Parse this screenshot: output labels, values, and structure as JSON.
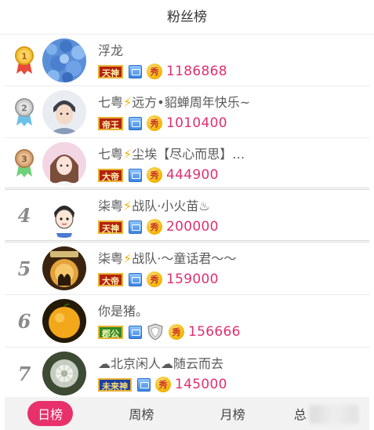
{
  "header": {
    "title": "粉丝榜"
  },
  "rows": [
    {
      "rank": "",
      "name_a": "浮龙",
      "name_b": "",
      "title": "天神",
      "score": "1186868"
    },
    {
      "rank": "",
      "name_a": "七粤",
      "name_b": "远方•貂蝉周年快乐~",
      "title": "帝王",
      "score": "1010400"
    },
    {
      "rank": "",
      "name_a": "七粤",
      "name_b": "尘埃【尽心而思】…",
      "title": "大帝",
      "score": "444900"
    },
    {
      "rank": "4",
      "name_a": "柒粤",
      "name_b": "战队·小火苗♨",
      "title": "天神",
      "score": "200000"
    },
    {
      "rank": "5",
      "name_a": "柒粤",
      "name_b": "战队·～童话君～～",
      "title": "大帝",
      "score": "159000"
    },
    {
      "rank": "6",
      "name_a": "你是猪。",
      "name_b": "",
      "title": "郡公",
      "score": "156666"
    },
    {
      "rank": "7",
      "name_a": "☁北京闲人☁随云而去",
      "name_b": "",
      "title": "未来神",
      "score": "145000"
    }
  ],
  "medals": [
    "1",
    "2",
    "3"
  ],
  "xiu_label": "秀",
  "bolt": "⚡",
  "tabs": [
    {
      "label": "日榜",
      "active": true
    },
    {
      "label": "周榜",
      "active": false
    },
    {
      "label": "月榜",
      "active": false
    },
    {
      "label": "总",
      "active": false
    }
  ],
  "colors": {
    "accent": "#e8306b",
    "score": "#e0306f",
    "gold": "#f2b300",
    "silver": "#b5b5b5",
    "bronze": "#c89060"
  },
  "icons": {
    "medal": "medal-icon",
    "level": "level-badge-icon",
    "coin": "xiu-coin-icon",
    "shield": "shield-icon",
    "bolt": "lightning-icon"
  }
}
